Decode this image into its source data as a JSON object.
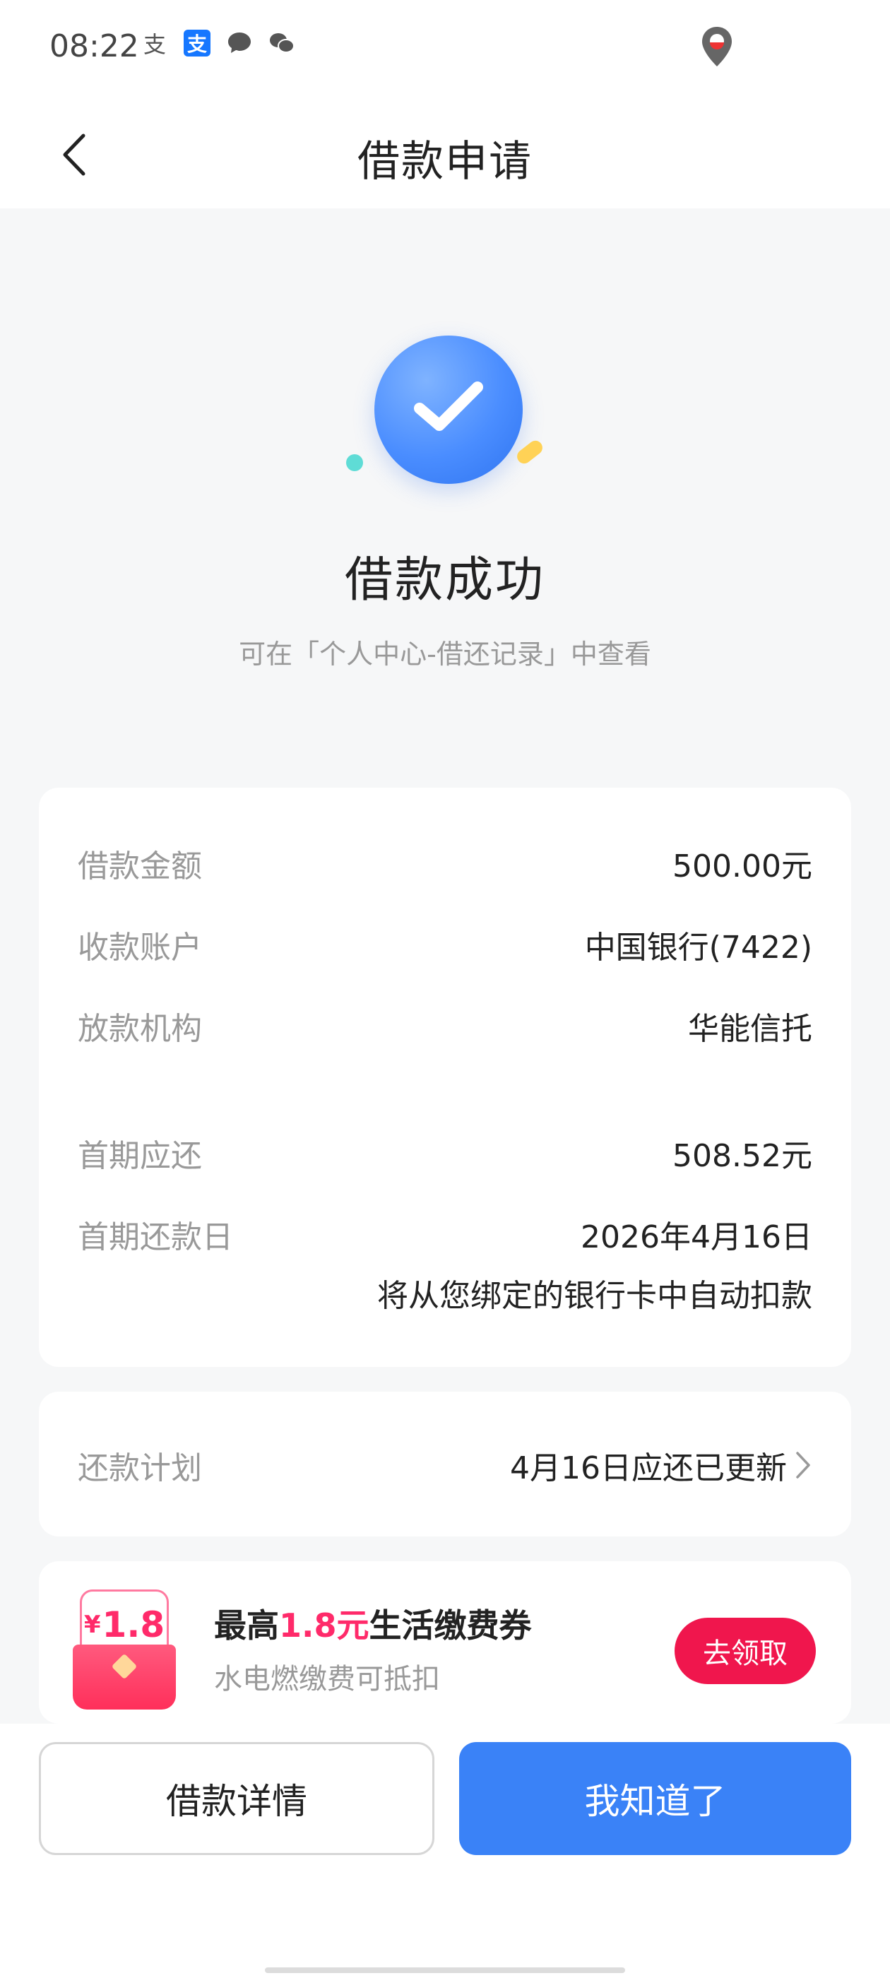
{
  "status_bar": {
    "time": "08:22",
    "icons": [
      "alipay-icon",
      "alipay-box-icon",
      "message-icon",
      "wechat-icon",
      "location-pin-icon"
    ]
  },
  "nav": {
    "title": "借款申请",
    "back_icon": "chevron-left-icon"
  },
  "hero": {
    "title": "借款成功",
    "subtitle": "可在「个人中心-借还记录」中查看",
    "accent_color": "#3a82f7"
  },
  "info": {
    "rows": [
      {
        "label": "借款金额",
        "value": "500.00元"
      },
      {
        "label": "收款账户",
        "value": "中国银行(7422)"
      },
      {
        "label": "放款机构",
        "value": "华能信托"
      },
      {
        "label": "首期应还",
        "value": "508.52元"
      },
      {
        "label": "首期还款日",
        "value": "2026年4月16日"
      }
    ],
    "note": "将从您绑定的银行卡中自动扣款"
  },
  "plan": {
    "label": "还款计划",
    "value": "4月16日应还已更新"
  },
  "promo": {
    "badge_currency": "¥",
    "badge_amount": "1.8",
    "title_prefix": "最高",
    "title_highlight": "1.8元",
    "title_suffix": "生活缴费券",
    "subtitle": "水电燃缴费可抵扣",
    "button": "去领取",
    "highlight_color": "#ff2a6a"
  },
  "actions": {
    "detail": "借款详情",
    "ok": "我知道了"
  }
}
